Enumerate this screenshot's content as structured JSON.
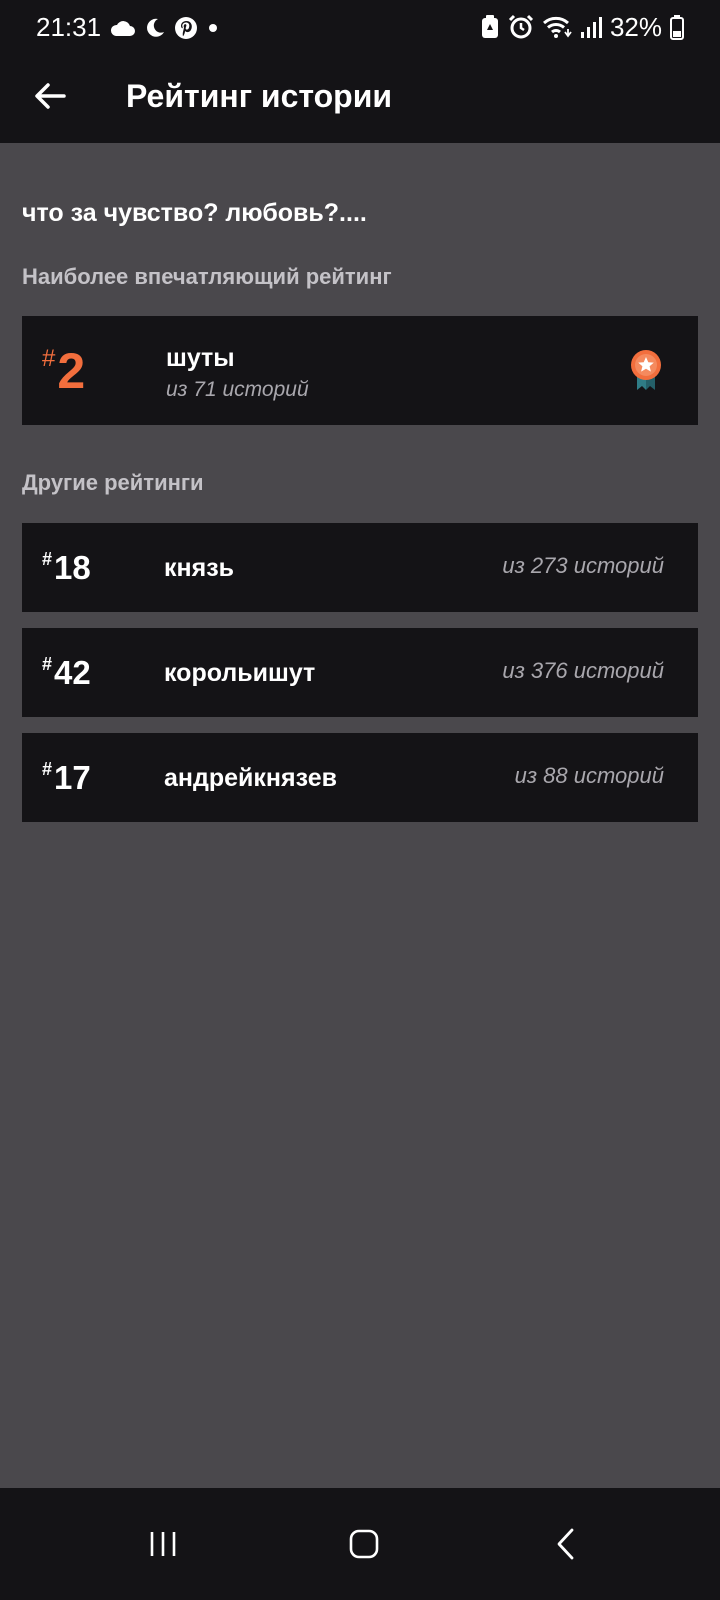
{
  "status_bar": {
    "time": "21:31",
    "battery": "32%",
    "left_icons": [
      "cloud-icon",
      "moon-icon",
      "pinterest-icon",
      "dot-icon"
    ],
    "right_icons": [
      "battery-saver-icon",
      "alarm-icon",
      "wifi-icon",
      "signal-icon",
      "battery-icon"
    ]
  },
  "app_bar": {
    "back_icon": "arrow-left-icon",
    "title": "Рейтинг истории"
  },
  "story": {
    "title": "что за чувство? любовь?...."
  },
  "featured": {
    "section_label": "Наиболее впечатляющий рейтинг",
    "hash": "#",
    "rank": "2",
    "tag": "шуты",
    "total": "из 71 историй",
    "badge_icon": "ribbon-star-badge-icon",
    "accent_color": "#f26e3d"
  },
  "others": {
    "section_label": "Другие рейтинги",
    "items": [
      {
        "hash": "#",
        "rank": "18",
        "tag": "князь",
        "total": "из 273 историй"
      },
      {
        "hash": "#",
        "rank": "42",
        "tag": "корольишут",
        "total": "из 376 историй"
      },
      {
        "hash": "#",
        "rank": "17",
        "tag": "андрейкнязев",
        "total": "из 88 историй"
      }
    ]
  },
  "nav_bar": {
    "recents_icon": "recent-apps-icon",
    "home_icon": "home-icon",
    "back_icon": "back-chevron-icon"
  }
}
